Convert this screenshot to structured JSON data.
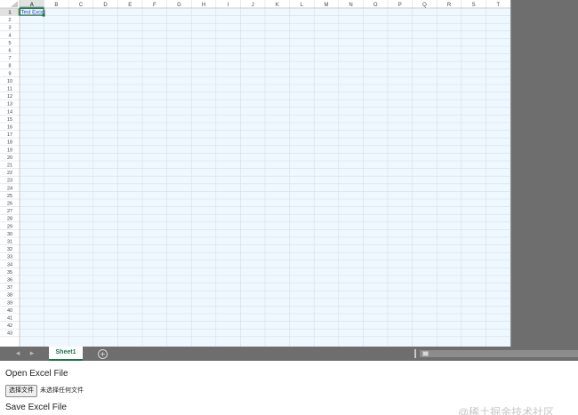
{
  "spreadsheet": {
    "columns": [
      "A",
      "B",
      "C",
      "D",
      "E",
      "F",
      "G",
      "H",
      "I",
      "J",
      "K",
      "L",
      "M",
      "N",
      "O",
      "P",
      "Q",
      "R",
      "S",
      "T"
    ],
    "rows": [
      "1",
      "2",
      "3",
      "4",
      "5",
      "6",
      "7",
      "8",
      "9",
      "10",
      "11",
      "12",
      "13",
      "14",
      "15",
      "16",
      "17",
      "18",
      "19",
      "20",
      "21",
      "22",
      "23",
      "24",
      "25",
      "26",
      "27",
      "28",
      "29",
      "30",
      "31",
      "32",
      "33",
      "34",
      "35",
      "36",
      "37",
      "38",
      "39",
      "40",
      "41",
      "42",
      "43"
    ],
    "active_cell": "A1",
    "cells": {
      "A1": "Test Excel"
    },
    "colors": {
      "cell_background": "#f0f8ff",
      "grid_line": "#d4dfe8",
      "header_background": "#ffffff",
      "header_text": "#444444",
      "selection_border": "#217346",
      "cell_text": "#1a3dbd",
      "outside_background": "#6e6e6e"
    }
  },
  "tabs": {
    "sheets": [
      {
        "label": "Sheet1",
        "active": true
      }
    ],
    "prev_icon": "triangle-left-icon",
    "next_icon": "triangle-right-icon",
    "add_icon": "plus-circle-icon",
    "prev_glyph": "◂",
    "next_glyph": "▸",
    "add_glyph": "+"
  },
  "page": {
    "open_title": "Open Excel File",
    "file_button_label": "选择文件",
    "file_status": "未选择任何文件",
    "save_title": "Save Excel File",
    "watermark": "@稀土掘金技术社区"
  }
}
